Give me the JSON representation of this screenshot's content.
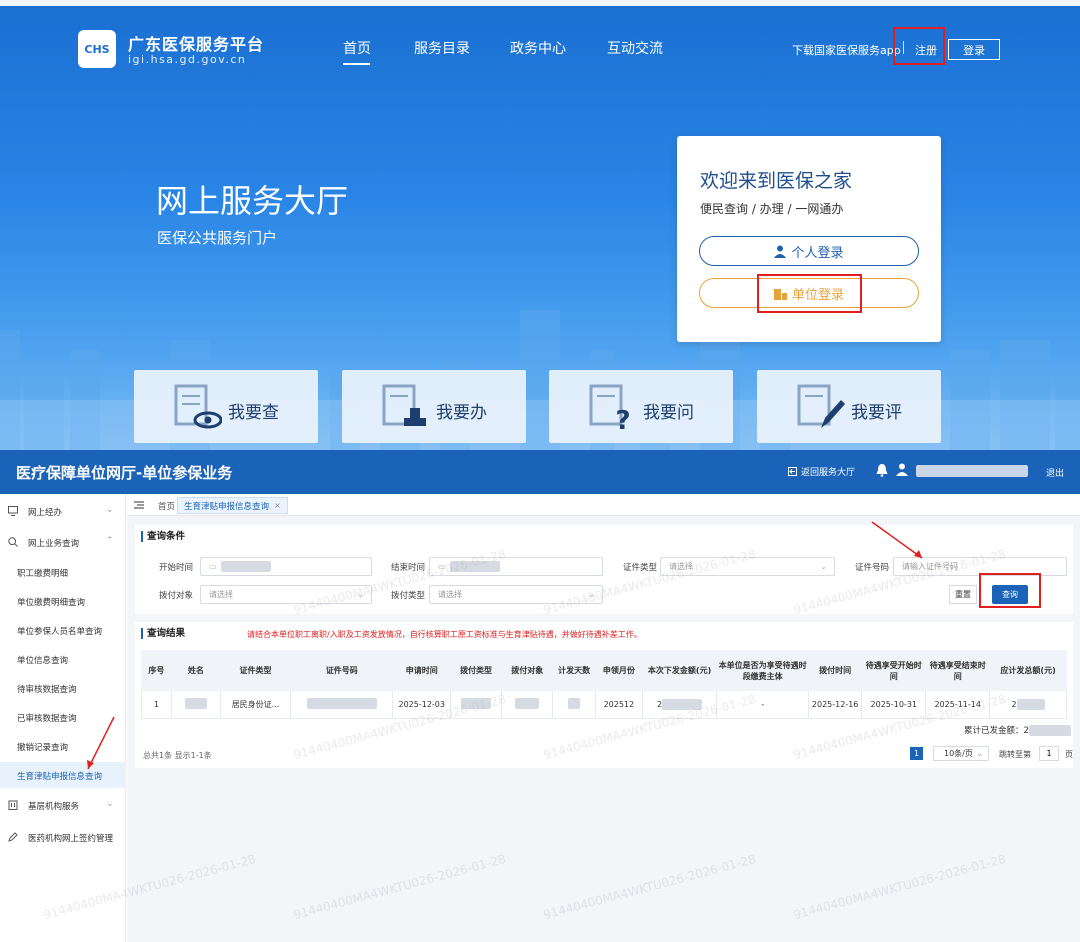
{
  "portal": {
    "logo_mark": "CHS",
    "site_name": "广东医保服务平台",
    "site_domain": "igi.hsa.gd.gov.cn",
    "nav": [
      "首页",
      "服务目录",
      "政务中心",
      "互动交流"
    ],
    "download_app": "下载国家医保服务app",
    "register": "注册",
    "login": "登录",
    "hero_title": "网上服务大厅",
    "hero_subtitle": "医保公共服务门户",
    "welcome_title": "欢迎来到医保之家",
    "welcome_subtitle": "便民查询 / 办理 / 一网通办",
    "personal_login": "个人登录",
    "unit_login": "单位登录",
    "services": [
      "我要查",
      "我要办",
      "我要问",
      "我要评"
    ]
  },
  "hall": {
    "title": "医疗保障单位网厅-单位参保业务",
    "return_link": "返回服务大厅",
    "logout": "退出"
  },
  "sidebar": {
    "groups": [
      {
        "label": "网上经办",
        "icon": "monitor-icon"
      },
      {
        "label": "网上业务查询",
        "icon": "search-icon"
      }
    ],
    "items": [
      "职工缴费明细",
      "单位缴费明细查询",
      "单位参保人员名单查询",
      "单位信息查询",
      "待审核数据查询",
      "已审核数据查询",
      "撤销记录查询",
      "生育津贴申报信息查询"
    ],
    "groups_bottom": [
      {
        "label": "基层机构服务",
        "icon": "building-icon"
      },
      {
        "label": "医药机构网上签约管理",
        "icon": "pen-icon"
      }
    ]
  },
  "tabs": {
    "home": "首页",
    "active": "生育津贴申报信息查询",
    "close": "×"
  },
  "query": {
    "title": "查询条件",
    "start_time_label": "开始时间",
    "end_time_label": "结束时间",
    "id_type_label": "证件类型",
    "id_type_placeholder": "请选择",
    "id_no_label": "证件号码",
    "id_no_placeholder": "请输入证件号码",
    "pay_target_label": "拨付对象",
    "pay_target_placeholder": "请选择",
    "pay_type_label": "拨付类型",
    "pay_type_placeholder": "请选择",
    "reset": "重置",
    "search": "查询"
  },
  "results": {
    "title": "查询结果",
    "notice": "请结合本单位职工离职/入职及工资发放情况，自行核算职工原工资标准与生育津贴待遇，并做好待遇补差工作。",
    "columns": [
      "序号",
      "姓名",
      "证件类型",
      "证件号码",
      "申请时间",
      "拨付类型",
      "拨付对象",
      "计发天数",
      "申领月份",
      "本次下发金额(元)",
      "本单位是否为享受待遇时段缴费主体",
      "拨付时间",
      "待遇享受开始时间",
      "待遇享受结束时间",
      "应计发总额(元)"
    ],
    "rows": [
      [
        "1",
        "",
        "居民身份证...",
        "",
        "2025-12-03",
        "",
        "",
        "",
        "202512",
        "2",
        "-",
        "2025-12-16",
        "2025-10-31",
        "2025-11-14",
        "2"
      ]
    ],
    "total_label": "累计已发金额：2",
    "summary": "总共1条 显示1-1条",
    "current_page": "1",
    "page_size": "10条/页",
    "jump_label": "跳转至第",
    "jump_value": "1",
    "page_unit": "页"
  },
  "watermark": "91440400MA4WKTU026-2026-01-28"
}
